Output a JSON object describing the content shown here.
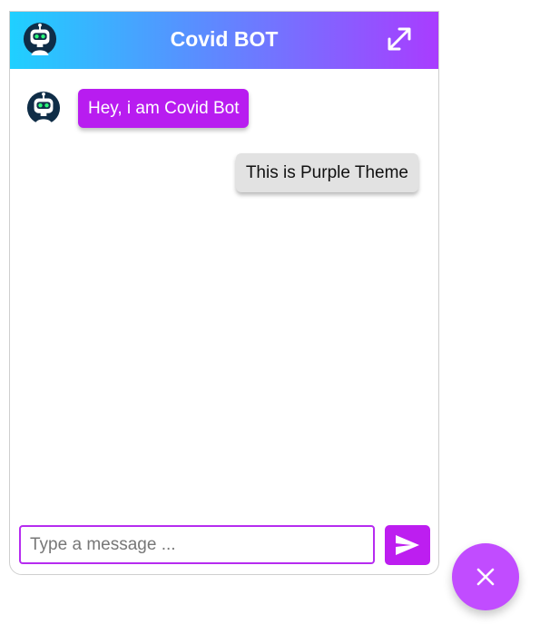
{
  "chat": {
    "title": "Covid BOT",
    "messages": [
      {
        "sender": "bot",
        "text": "Hey, i am Covid Bot"
      },
      {
        "sender": "user",
        "text": "This is Purple Theme"
      }
    ],
    "input": {
      "placeholder": "Type a message ...",
      "value": ""
    }
  },
  "icons": {
    "header_avatar": "robot-avatar-icon",
    "message_avatar": "robot-avatar-icon",
    "expand": "expand-icon",
    "send": "send-icon",
    "launcher": "close-icon"
  },
  "colors": {
    "header_gradient_start": "#1fd0ff",
    "header_gradient_end": "#a93cff",
    "bot_bubble": "#b81cf0",
    "user_bubble": "#e2e2e2",
    "accent": "#bd1ef0",
    "launcher": "#c14cff"
  }
}
